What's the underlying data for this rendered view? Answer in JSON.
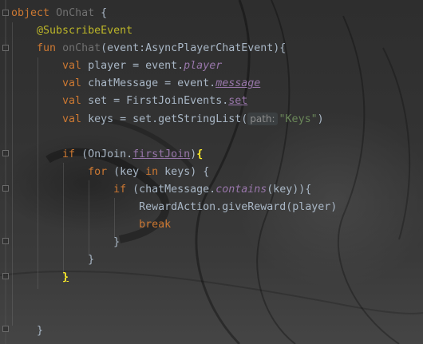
{
  "lines": {
    "l1": {
      "kw_object": "object",
      "name": "OnChat",
      "brace": " {"
    },
    "l2": {
      "annotation": "@SubscribeEvent"
    },
    "l3": {
      "kw_fun": "fun",
      "fname": "onChat",
      "params": "(event:AsyncPlayerChatEvent){"
    },
    "l4": {
      "kw_val": "val",
      "text": " player = event.",
      "prop": "player"
    },
    "l5": {
      "kw_val": "val",
      "text": " chatMessage = event.",
      "prop": "message"
    },
    "l6": {
      "kw_val": "val",
      "text": " set = FirstJoinEvents.",
      "prop": "set"
    },
    "l7": {
      "kw_val": "val",
      "text": " keys = set.getStringList(",
      "hint": "path:",
      "str": "\"Keys\"",
      "close": ")"
    },
    "l9": {
      "kw_if": "if",
      "open": " (OnJoin.",
      "field": "firstJoin",
      "close": ")",
      "brace": "{"
    },
    "l10": {
      "kw_for": "for",
      "open": " (key ",
      "kw_in": "in",
      "rest": " keys) {"
    },
    "l11": {
      "kw_if": "if",
      "open": " (chatMessage.",
      "call": "contains",
      "rest": "(key)){"
    },
    "l12": {
      "text": "RewardAction.giveReward(player)"
    },
    "l13": {
      "kw_break": "break"
    },
    "l14": {
      "text": "}"
    },
    "l15": {
      "text": "}"
    },
    "l16": {
      "brace": "}"
    },
    "l19": {
      "text": "}"
    }
  },
  "colors": {
    "keyword": "#cc7832",
    "function": "#ffc66d",
    "annotation": "#bbb529",
    "property": "#9876aa",
    "string": "#6a8759",
    "default": "#a9b7c6",
    "brace_match": "#ffef28"
  }
}
